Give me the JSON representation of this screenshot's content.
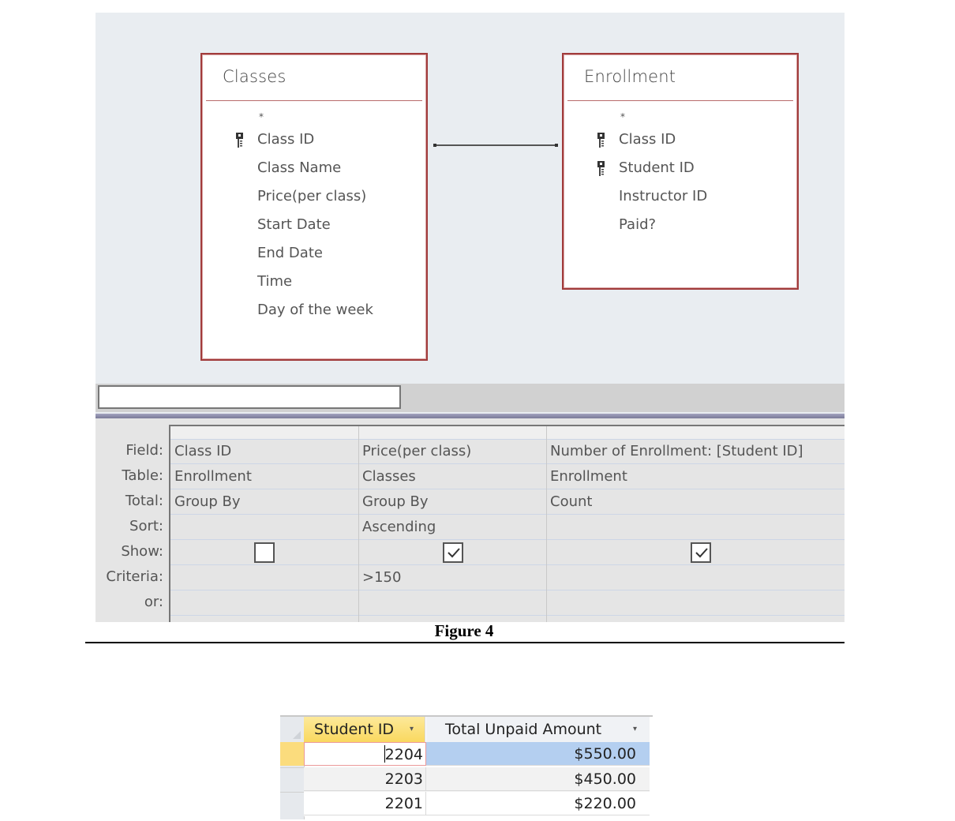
{
  "query_design": {
    "tables": [
      {
        "name": "Classes",
        "fields": [
          {
            "label": "*",
            "primary_key": false
          },
          {
            "label": "Class ID",
            "primary_key": true
          },
          {
            "label": "Class Name",
            "primary_key": false
          },
          {
            "label": "Price(per class)",
            "primary_key": false
          },
          {
            "label": "Start Date",
            "primary_key": false
          },
          {
            "label": "End Date",
            "primary_key": false
          },
          {
            "label": "Time",
            "primary_key": false
          },
          {
            "label": "Day of the week",
            "primary_key": false
          }
        ]
      },
      {
        "name": "Enrollment",
        "fields": [
          {
            "label": "*",
            "primary_key": false
          },
          {
            "label": "Class ID",
            "primary_key": true
          },
          {
            "label": "Student ID",
            "primary_key": true
          },
          {
            "label": "Instructor ID",
            "primary_key": false
          },
          {
            "label": "Paid?",
            "primary_key": false
          }
        ]
      }
    ],
    "relationship": {
      "from": "Classes.Class ID",
      "to": "Enrollment.Class ID"
    },
    "grid": {
      "row_labels": [
        "Field:",
        "Table:",
        "Total:",
        "Sort:",
        "Show:",
        "Criteria:",
        "or:"
      ],
      "columns": [
        {
          "field": "Class ID",
          "table": "Enrollment",
          "total": "Group By",
          "sort": "",
          "show": false,
          "criteria": "",
          "or": ""
        },
        {
          "field": "Price(per class)",
          "table": "Classes",
          "total": "Group By",
          "sort": "Ascending",
          "show": true,
          "criteria": ">150",
          "or": ""
        },
        {
          "field": "Number of Enrollment: [Student ID]",
          "table": "Enrollment",
          "total": "Count",
          "sort": "",
          "show": true,
          "criteria": "",
          "or": ""
        }
      ]
    }
  },
  "caption": "Figure 4",
  "datasheet": {
    "columns": [
      "Student ID",
      "Total Unpaid Amount"
    ],
    "rows": [
      {
        "student_id": "2204",
        "total_unpaid": "$550.00",
        "active": true
      },
      {
        "student_id": "2203",
        "total_unpaid": "$450.00",
        "active": false
      },
      {
        "student_id": "2201",
        "total_unpaid": "$220.00",
        "active": false
      }
    ],
    "colors": {
      "header_active": "#f9d85f",
      "selected_cell": "#b4cff0",
      "table_border": "#a13b3b"
    }
  }
}
